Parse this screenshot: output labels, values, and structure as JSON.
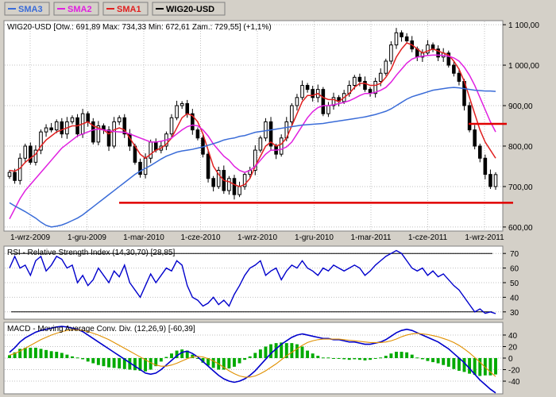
{
  "legend": [
    {
      "label": "SMA3",
      "color": "#3a6cd8"
    },
    {
      "label": "SMA2",
      "color": "#e020e0"
    },
    {
      "label": "SMA1",
      "color": "#e02020"
    },
    {
      "label": "WIG20-USD",
      "color": "#000000"
    }
  ],
  "chart_data": [
    {
      "type": "candlestick",
      "title": "WIG20-USD [Otw.: 691,89  Max: 734,33  Min: 672,61  Zam.: 729,55] (+1,1%)",
      "x_ticks": [
        "1-wrz-2009",
        "1-gru-2009",
        "1-mar-2010",
        "1-cze-2010",
        "1-wrz-2010",
        "1-gru-2010",
        "1-mar-2011",
        "1-cze-2011",
        "1-wrz-2011"
      ],
      "y_ticks": [
        "1 100,00",
        "1 000,00",
        "900,00",
        "800,00",
        "700,00",
        "600,00"
      ],
      "ylim": [
        590,
        1110
      ],
      "closes": [
        735,
        715,
        770,
        800,
        760,
        790,
        835,
        845,
        840,
        860,
        830,
        860,
        870,
        830,
        880,
        860,
        810,
        850,
        840,
        800,
        860,
        870,
        830,
        800,
        760,
        730,
        770,
        810,
        790,
        800,
        830,
        870,
        900,
        905,
        880,
        840,
        820,
        780,
        720,
        700,
        740,
        690,
        720,
        680,
        700,
        730,
        740,
        790,
        820,
        860,
        800,
        780,
        820,
        860,
        900,
        920,
        950,
        940,
        920,
        940,
        880,
        900,
        920,
        910,
        930,
        950,
        970,
        960,
        940,
        930,
        960,
        980,
        1010,
        1050,
        1080,
        1070,
        1060,
        1040,
        1020,
        1030,
        1050,
        1040,
        1020,
        1030,
        1000,
        980,
        960,
        900,
        840,
        800,
        770,
        730,
        700,
        729.55
      ],
      "series": [
        {
          "name": "SMA1",
          "color": "#e02020",
          "values": [
            740,
            738,
            745,
            760,
            770,
            780,
            800,
            815,
            825,
            835,
            840,
            845,
            850,
            850,
            855,
            860,
            850,
            845,
            840,
            830,
            840,
            845,
            840,
            820,
            800,
            780,
            770,
            780,
            790,
            795,
            805,
            820,
            845,
            870,
            880,
            875,
            860,
            830,
            790,
            750,
            730,
            715,
            712,
            705,
            700,
            705,
            720,
            750,
            775,
            800,
            810,
            800,
            805,
            820,
            850,
            880,
            910,
            925,
            925,
            930,
            920,
            915,
            915,
            910,
            920,
            930,
            945,
            955,
            955,
            950,
            950,
            955,
            970,
            990,
            1020,
            1040,
            1055,
            1050,
            1040,
            1030,
            1035,
            1040,
            1035,
            1030,
            1025,
            1010,
            990,
            960,
            920,
            880,
            840,
            810,
            790,
            770
          ]
        },
        {
          "name": "SMA2",
          "color": "#e020e0",
          "values": [
            620,
            645,
            670,
            690,
            705,
            720,
            735,
            750,
            765,
            780,
            795,
            805,
            815,
            825,
            830,
            835,
            840,
            842,
            840,
            838,
            836,
            835,
            834,
            830,
            825,
            820,
            815,
            810,
            810,
            812,
            815,
            820,
            830,
            840,
            848,
            852,
            850,
            840,
            825,
            805,
            790,
            775,
            765,
            750,
            740,
            735,
            740,
            750,
            765,
            780,
            790,
            790,
            792,
            798,
            810,
            830,
            850,
            870,
            885,
            895,
            900,
            900,
            902,
            905,
            908,
            912,
            918,
            925,
            930,
            930,
            933,
            938,
            945,
            958,
            975,
            990,
            1005,
            1015,
            1020,
            1022,
            1024,
            1025,
            1025,
            1024,
            1022,
            1018,
            1010,
            995,
            975,
            950,
            920,
            890,
            860,
            835
          ]
        },
        {
          "name": "SMA3",
          "color": "#3a6cd8",
          "values": [
            660,
            652,
            645,
            638,
            630,
            622,
            612,
            604,
            600,
            602,
            605,
            610,
            616,
            622,
            630,
            640,
            650,
            660,
            670,
            680,
            690,
            700,
            710,
            720,
            730,
            738,
            745,
            752,
            760,
            768,
            775,
            780,
            785,
            788,
            790,
            792,
            795,
            798,
            802,
            806,
            810,
            815,
            818,
            820,
            824,
            826,
            830,
            834,
            836,
            838,
            840,
            842,
            844,
            846,
            848,
            850,
            852,
            853,
            854,
            855,
            856,
            858,
            860,
            862,
            864,
            866,
            868,
            870,
            872,
            875,
            878,
            882,
            886,
            892,
            900,
            908,
            916,
            922,
            926,
            930,
            934,
            938,
            940,
            942,
            944,
            945,
            944,
            942,
            940,
            938,
            937,
            936,
            936,
            935
          ]
        }
      ],
      "reference_lines": [
        {
          "value": 660,
          "color": "#e00000"
        },
        {
          "value": 855,
          "color": "#e00000"
        }
      ]
    },
    {
      "type": "line",
      "title": "RSI - Relative Strength Index (14,30,70) [28,85]",
      "y_ticks": [
        "70",
        "60",
        "50",
        "40",
        "30"
      ],
      "ylim": [
        25,
        75
      ],
      "reference_lines": [
        {
          "value": 70,
          "color": "#000000"
        },
        {
          "value": 30,
          "color": "#000000"
        }
      ],
      "series": [
        {
          "name": "RSI",
          "color": "#0000cc",
          "values": [
            60,
            68,
            60,
            62,
            55,
            65,
            68,
            58,
            62,
            68,
            66,
            60,
            62,
            50,
            55,
            48,
            52,
            60,
            55,
            50,
            58,
            54,
            62,
            50,
            45,
            40,
            48,
            56,
            50,
            55,
            60,
            58,
            65,
            62,
            48,
            40,
            38,
            34,
            36,
            40,
            35,
            38,
            34,
            42,
            48,
            55,
            60,
            62,
            65,
            55,
            58,
            60,
            52,
            58,
            62,
            60,
            65,
            60,
            58,
            55,
            60,
            58,
            62,
            60,
            58,
            60,
            62,
            60,
            55,
            58,
            62,
            65,
            68,
            70,
            72,
            70,
            65,
            60,
            58,
            60,
            55,
            58,
            54,
            56,
            52,
            48,
            45,
            40,
            35,
            30,
            32,
            29,
            30,
            28.85
          ]
        }
      ]
    },
    {
      "type": "bar+line",
      "title": "MACD - Moving Average Conv. Div. (12,26,9) [-60,39]",
      "y_ticks": [
        "40",
        "20",
        "0",
        "-20",
        "-40"
      ],
      "ylim": [
        -62,
        62
      ],
      "series": [
        {
          "name": "MACD",
          "color": "#0000cc",
          "values": [
            10,
            18,
            28,
            35,
            40,
            45,
            48,
            50,
            52,
            54,
            55,
            54,
            52,
            50,
            46,
            40,
            34,
            28,
            22,
            16,
            10,
            4,
            -2,
            -8,
            -14,
            -20,
            -26,
            -28,
            -26,
            -20,
            -12,
            -4,
            4,
            10,
            12,
            8,
            2,
            -6,
            -14,
            -22,
            -30,
            -36,
            -40,
            -42,
            -40,
            -36,
            -30,
            -22,
            -12,
            -2,
            8,
            16,
            24,
            30,
            36,
            40,
            42,
            40,
            38,
            36,
            34,
            34,
            32,
            32,
            30,
            28,
            28,
            26,
            24,
            24,
            26,
            28,
            32,
            38,
            44,
            48,
            50,
            48,
            44,
            40,
            36,
            32,
            28,
            22,
            16,
            8,
            0,
            -8,
            -18,
            -28,
            -38,
            -46,
            -54,
            -60.39
          ]
        },
        {
          "name": "Signal",
          "color": "#e09000",
          "values": [
            5,
            8,
            12,
            17,
            22,
            27,
            32,
            36,
            40,
            43,
            46,
            48,
            49,
            49,
            48,
            46,
            43,
            40,
            36,
            32,
            27,
            22,
            17,
            12,
            7,
            2,
            -3,
            -8,
            -12,
            -14,
            -14,
            -12,
            -9,
            -5,
            -1,
            2,
            3,
            2,
            -1,
            -5,
            -10,
            -16,
            -22,
            -27,
            -31,
            -33,
            -33,
            -31,
            -27,
            -22,
            -16,
            -10,
            -3,
            4,
            10,
            16,
            22,
            27,
            30,
            32,
            33,
            33,
            33,
            33,
            32,
            31,
            30,
            29,
            28,
            27,
            27,
            27,
            28,
            30,
            33,
            37,
            40,
            42,
            43,
            42,
            41,
            39,
            37,
            34,
            31,
            27,
            22,
            16,
            9,
            1,
            -7,
            -16,
            -24,
            -32
          ]
        }
      ],
      "histogram_color_pos": "#00aa00",
      "histogram_color_neg": "#00aa00"
    }
  ]
}
